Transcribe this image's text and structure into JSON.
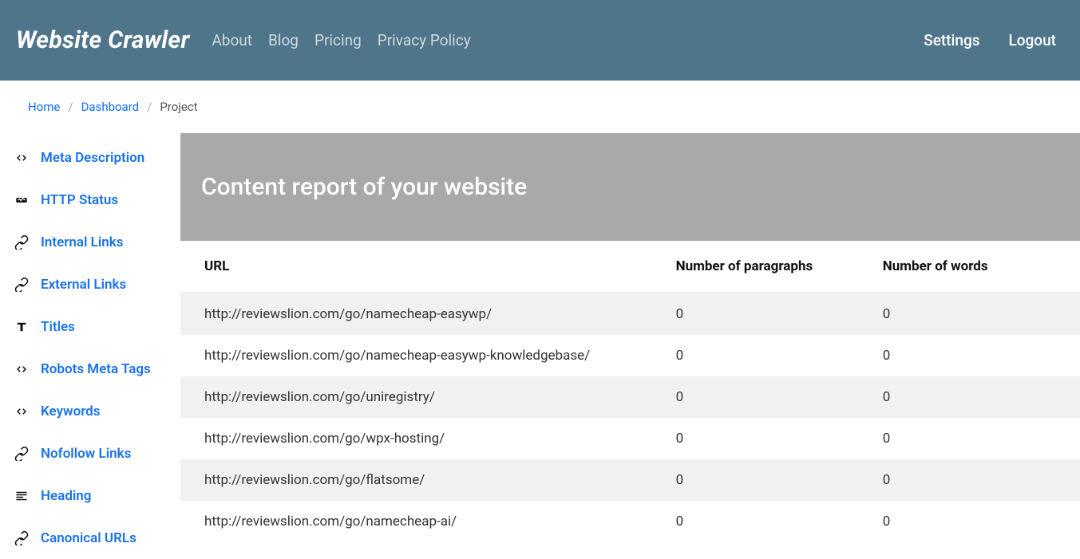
{
  "topbar": {
    "brand": "Website Crawler",
    "nav": [
      "About",
      "Blog",
      "Pricing",
      "Privacy Policy"
    ],
    "right": {
      "settings": "Settings",
      "logout": "Logout"
    }
  },
  "breadcrumb": {
    "home": "Home",
    "dashboard": "Dashboard",
    "current": "Project"
  },
  "sidebar": {
    "items": [
      {
        "icon": "code-icon",
        "label": "Meta Description"
      },
      {
        "icon": "status-icon",
        "label": "HTTP Status"
      },
      {
        "icon": "link-icon",
        "label": "Internal Links"
      },
      {
        "icon": "link-icon",
        "label": "External Links"
      },
      {
        "icon": "title-icon",
        "label": "Titles"
      },
      {
        "icon": "code-icon",
        "label": "Robots Meta Tags"
      },
      {
        "icon": "code-icon",
        "label": "Keywords"
      },
      {
        "icon": "link-icon",
        "label": "Nofollow Links"
      },
      {
        "icon": "heading-icon",
        "label": "Heading"
      },
      {
        "icon": "link-icon",
        "label": "Canonical URLs"
      }
    ]
  },
  "main": {
    "banner_title": "Content report of your website",
    "table": {
      "headers": {
        "url": "URL",
        "paragraphs": "Number of paragraphs",
        "words": "Number of words"
      },
      "rows": [
        {
          "url": "http://reviewslion.com/go/namecheap-easywp/",
          "paragraphs": "0",
          "words": "0"
        },
        {
          "url": "http://reviewslion.com/go/namecheap-easywp-knowledgebase/",
          "paragraphs": "0",
          "words": "0"
        },
        {
          "url": "http://reviewslion.com/go/uniregistry/",
          "paragraphs": "0",
          "words": "0"
        },
        {
          "url": "http://reviewslion.com/go/wpx-hosting/",
          "paragraphs": "0",
          "words": "0"
        },
        {
          "url": "http://reviewslion.com/go/flatsome/",
          "paragraphs": "0",
          "words": "0"
        },
        {
          "url": "http://reviewslion.com/go/namecheap-ai/",
          "paragraphs": "0",
          "words": "0"
        }
      ]
    }
  }
}
